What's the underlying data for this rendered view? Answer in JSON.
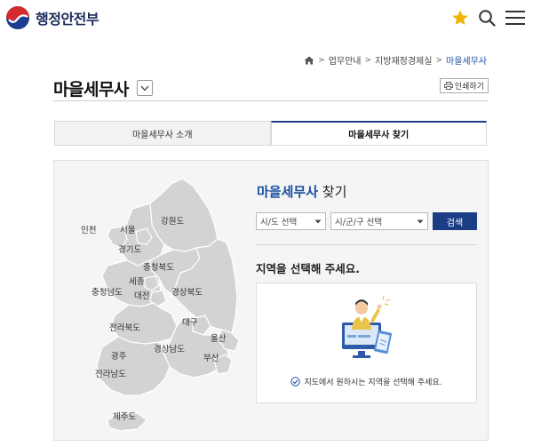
{
  "header": {
    "logo_text": "행정안전부",
    "icons": [
      "government-emblem-icon",
      "star-icon",
      "search-icon",
      "menu-icon"
    ],
    "accent_color": "#f0b400"
  },
  "breadcrumb": {
    "items": [
      "업무안내",
      "지방재정경제실",
      "마을세무사"
    ],
    "separator": ">"
  },
  "page": {
    "title": "마을세무사",
    "print_label": "인쇄하기"
  },
  "tabs": [
    {
      "label": "마을세무사 소개",
      "active": false
    },
    {
      "label": "마을세무사 찾기",
      "active": true
    }
  ],
  "finder": {
    "title_highlight": "마을세무사",
    "title_rest": " 찾기",
    "province_select": "시/도 선택",
    "district_select": "시/군/구 선택",
    "search_label": "검색",
    "region_heading": "지역을 선택해 주세요.",
    "hint": "지도에서 원하시는 지역을 선택해 주세요."
  },
  "map": {
    "regions": [
      "인천",
      "서울",
      "강원도",
      "경기도",
      "충청북도",
      "세종",
      "충청남도",
      "대전",
      "경상북도",
      "전라북도",
      "대구",
      "울산",
      "광주",
      "경상남도",
      "부산",
      "전라남도",
      "제주도"
    ]
  },
  "colors": {
    "primary": "#1b3d86",
    "link": "#1a4fa0",
    "map_fill": "#d3d3d3"
  }
}
